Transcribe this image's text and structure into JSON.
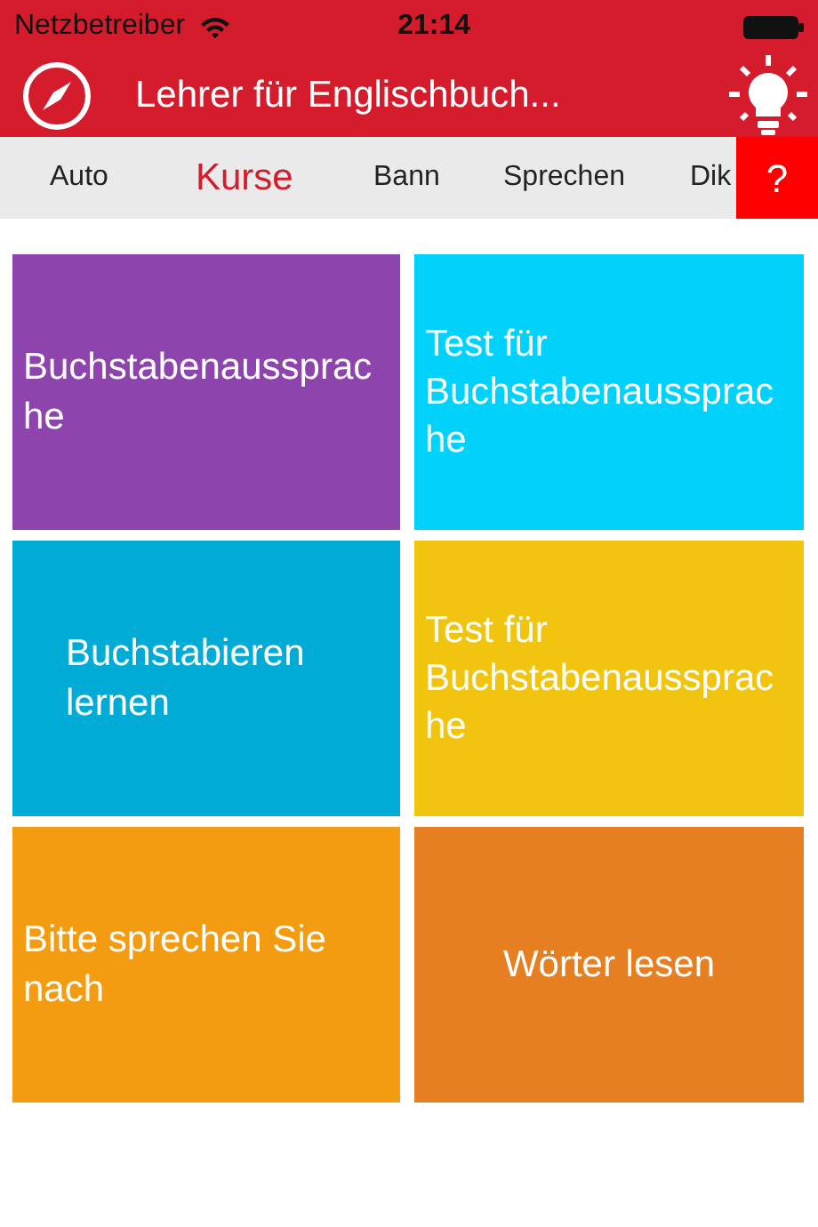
{
  "status_bar": {
    "carrier": "Netzbetreiber",
    "time": "21:14"
  },
  "nav_bar": {
    "title": "Lehrer für Englischbuch..."
  },
  "tabs": [
    {
      "label": "Auto",
      "selected": false
    },
    {
      "label": "Kurse",
      "selected": true
    },
    {
      "label": "Bann",
      "selected": false
    },
    {
      "label": "Sprechen",
      "selected": false
    },
    {
      "label": "Dik",
      "selected": false
    }
  ],
  "help_button": {
    "label": "?"
  },
  "tiles": [
    {
      "label": "Buchstabenaussprache",
      "color": "#8e44ad",
      "kind": "left"
    },
    {
      "label": "Test für Buchstabenaussprache",
      "color": "#00d2fb",
      "kind": "left"
    },
    {
      "label": "Buchstabieren lernen",
      "color": "#00acd6",
      "kind": "inset"
    },
    {
      "label": "Test für Buchstabenaussprache",
      "color": "#f1c40f",
      "kind": "left"
    },
    {
      "label": "Bitte sprechen Sie nach",
      "color": "#f39c12",
      "kind": "left"
    },
    {
      "label": "Wörter lesen",
      "color": "#e67e22",
      "kind": "center"
    }
  ]
}
